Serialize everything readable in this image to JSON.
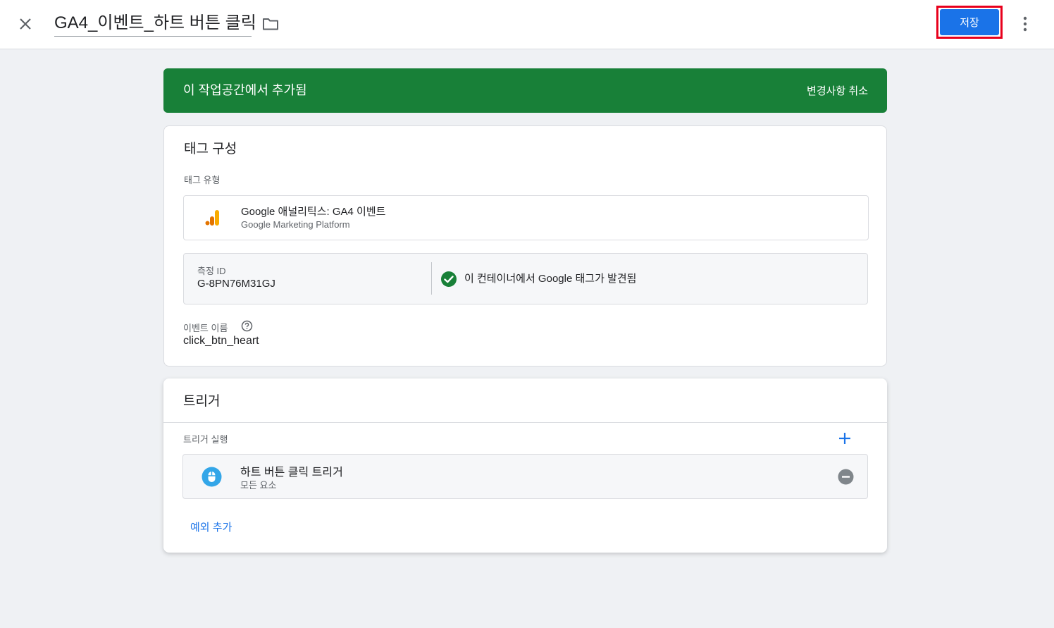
{
  "header": {
    "title": "GA4_이벤트_하트 버튼 클릭",
    "save_label": "저장",
    "close_icon": "close-icon",
    "folder_icon": "folder-icon",
    "more_icon": "more-vert-icon"
  },
  "banner": {
    "text": "이 작업공간에서 추가됨",
    "discard_label": "변경사항 취소",
    "color": "#188038"
  },
  "tag_config": {
    "title": "태그 구성",
    "tag_type_label": "태그 유형",
    "tag_type_name": "Google 애널리틱스: GA4 이벤트",
    "tag_type_provider": "Google Marketing Platform",
    "measurement_id_label": "측정 ID",
    "measurement_id": "G-8PN76M31GJ",
    "google_tag_status": "이 컨테이너에서 Google 태그가 발견됨",
    "event_name_label": "이벤트 이름",
    "event_name": "click_btn_heart"
  },
  "triggering": {
    "title": "트리거",
    "firing_label": "트리거 실행",
    "triggers": [
      {
        "name": "하트 버튼 클릭 트리거",
        "subtitle": "모든 요소"
      }
    ],
    "add_exception_label": "예외 추가"
  },
  "colors": {
    "accent": "#1a73e8",
    "success": "#188038",
    "highlight_outline": "#e8001c"
  }
}
